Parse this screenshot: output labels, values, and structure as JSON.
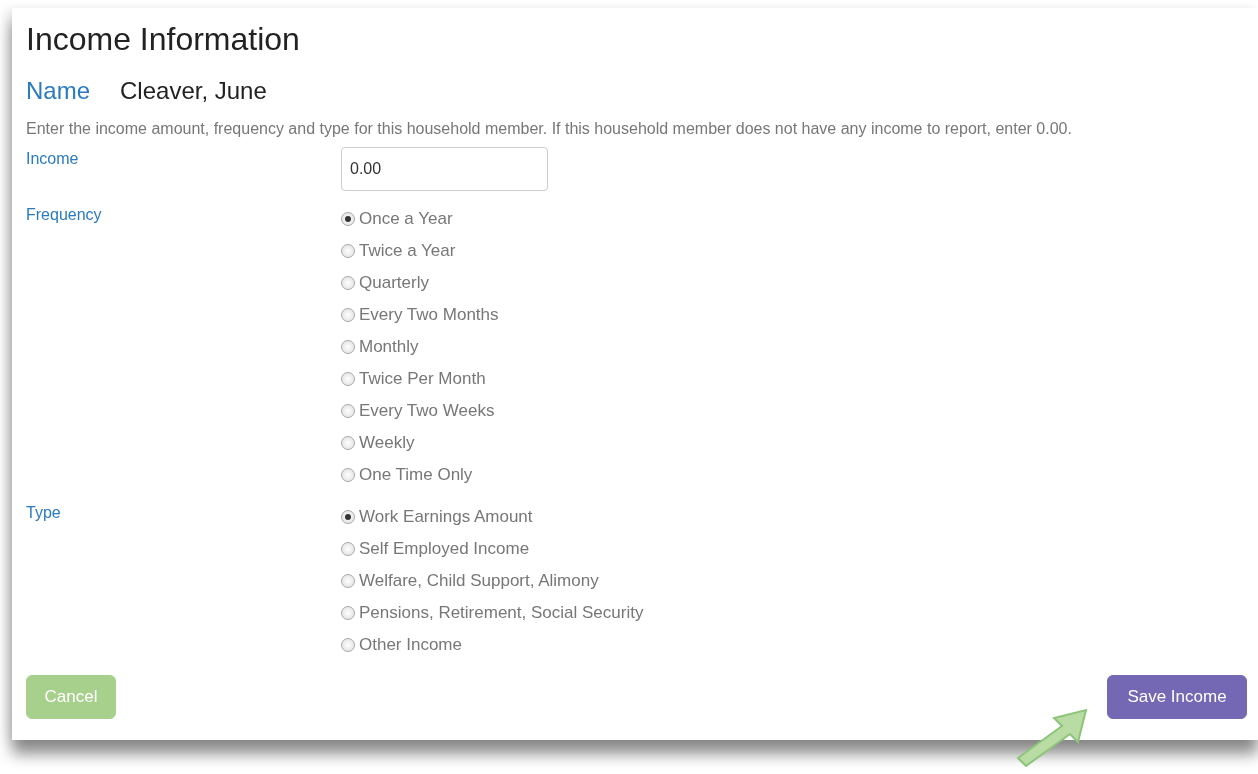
{
  "title": "Income Information",
  "name": {
    "label": "Name",
    "value": "Cleaver, June"
  },
  "instructions": "Enter the income amount, frequency and type for this household member. If this household member does not have any income to report, enter 0.00.",
  "income": {
    "label": "Income",
    "value": "0.00"
  },
  "groups": [
    {
      "label": "Frequency",
      "options": [
        {
          "label": "Once a Year",
          "selected": true
        },
        {
          "label": "Twice a Year",
          "selected": false
        },
        {
          "label": "Quarterly",
          "selected": false
        },
        {
          "label": "Every Two Months",
          "selected": false
        },
        {
          "label": "Monthly",
          "selected": false
        },
        {
          "label": "Twice Per Month",
          "selected": false
        },
        {
          "label": "Every Two Weeks",
          "selected": false
        },
        {
          "label": "Weekly",
          "selected": false
        },
        {
          "label": "One Time Only",
          "selected": false
        }
      ]
    },
    {
      "label": "Type",
      "options": [
        {
          "label": "Work Earnings Amount",
          "selected": true
        },
        {
          "label": "Self Employed Income",
          "selected": false
        },
        {
          "label": "Welfare, Child Support, Alimony",
          "selected": false
        },
        {
          "label": "Pensions, Retirement, Social Security",
          "selected": false
        },
        {
          "label": "Other Income",
          "selected": false
        }
      ]
    }
  ],
  "buttons": [
    {
      "label": "Cancel",
      "kind": "cancel"
    },
    {
      "label": "Save Income",
      "kind": "save"
    }
  ]
}
